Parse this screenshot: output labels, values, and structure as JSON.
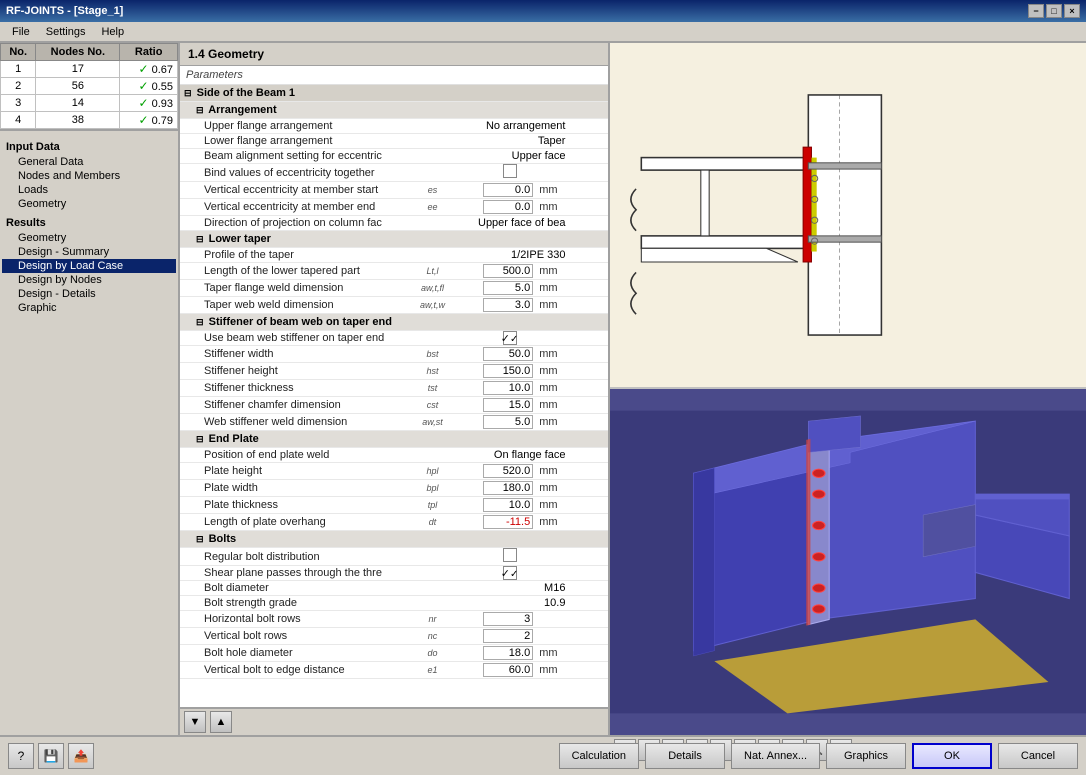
{
  "titleBar": {
    "title": "RF-JOINTS - [Stage_1]",
    "closeBtn": "×",
    "minBtn": "−",
    "maxBtn": "□"
  },
  "menuBar": {
    "items": [
      "File",
      "Settings",
      "Help"
    ]
  },
  "nodeTable": {
    "headers": [
      "No.",
      "Nodes No.",
      "Ratio"
    ],
    "rows": [
      {
        "no": 1,
        "nodes": 17,
        "ratio": "0.67",
        "ok": true
      },
      {
        "no": 2,
        "nodes": 56,
        "ratio": "0.55",
        "ok": true
      },
      {
        "no": 3,
        "nodes": 14,
        "ratio": "0.93",
        "ok": true
      },
      {
        "no": 4,
        "nodes": 38,
        "ratio": "0.79",
        "ok": true
      }
    ]
  },
  "inputTree": {
    "inputDataLabel": "Input Data",
    "items": [
      {
        "label": "General Data",
        "indent": 1
      },
      {
        "label": "Nodes and Members",
        "indent": 1
      },
      {
        "label": "Loads",
        "indent": 1
      },
      {
        "label": "Geometry",
        "indent": 1
      }
    ],
    "resultsLabel": "Results",
    "resultItems": [
      {
        "label": "Geometry",
        "indent": 1
      },
      {
        "label": "Design - Summary",
        "indent": 1
      },
      {
        "label": "Design by Load Case",
        "indent": 1
      },
      {
        "label": "Design by Nodes",
        "indent": 1
      },
      {
        "label": "Design - Details",
        "indent": 1
      },
      {
        "label": "Graphic",
        "indent": 1
      }
    ]
  },
  "centerPanel": {
    "title": "1.4 Geometry",
    "paramsLabel": "Parameters",
    "sections": [
      {
        "type": "section",
        "label": "Side of the Beam 1",
        "subsections": [
          {
            "type": "subsection",
            "label": "Arrangement",
            "rows": [
              {
                "name": "Upper flange arrangement",
                "symbol": "",
                "value": "No arrangement",
                "unit": "",
                "type": "text"
              },
              {
                "name": "Lower flange arrangement",
                "symbol": "",
                "value": "Taper",
                "unit": "",
                "type": "text"
              },
              {
                "name": "Beam alignment setting for eccentric",
                "symbol": "",
                "value": "Upper face",
                "unit": "",
                "type": "text"
              },
              {
                "name": "Bind values of eccentricity together",
                "symbol": "",
                "value": "",
                "unit": "",
                "type": "checkbox",
                "checked": false
              },
              {
                "name": "Vertical eccentricity at member start",
                "symbol": "es",
                "value": "0.0",
                "unit": "mm",
                "type": "value"
              },
              {
                "name": "Vertical eccentricity at member end",
                "symbol": "ee",
                "value": "0.0",
                "unit": "mm",
                "type": "value"
              },
              {
                "name": "Direction of projection on column fac",
                "symbol": "",
                "value": "Upper face of bea",
                "unit": "",
                "type": "text"
              }
            ]
          },
          {
            "type": "subsection",
            "label": "Lower taper",
            "rows": [
              {
                "name": "Profile of the taper",
                "symbol": "",
                "value": "1/2IPE 330",
                "unit": "",
                "type": "text"
              },
              {
                "name": "Length of the lower tapered part",
                "symbol": "Lt,l",
                "value": "500.0",
                "unit": "mm",
                "type": "value"
              },
              {
                "name": "Taper flange weld dimension",
                "symbol": "aw,t,fl",
                "value": "5.0",
                "unit": "mm",
                "type": "value"
              },
              {
                "name": "Taper web weld dimension",
                "symbol": "aw,t,w",
                "value": "3.0",
                "unit": "mm",
                "type": "value"
              }
            ]
          },
          {
            "type": "subsection",
            "label": "Stiffener of beam web on taper end",
            "rows": [
              {
                "name": "Use beam web stiffener on taper end",
                "symbol": "",
                "value": "",
                "unit": "",
                "type": "checkbox",
                "checked": true
              },
              {
                "name": "Stiffener width",
                "symbol": "bst",
                "value": "50.0",
                "unit": "mm",
                "type": "value"
              },
              {
                "name": "Stiffener height",
                "symbol": "hst",
                "value": "150.0",
                "unit": "mm",
                "type": "value"
              },
              {
                "name": "Stiffener thickness",
                "symbol": "tst",
                "value": "10.0",
                "unit": "mm",
                "type": "value"
              },
              {
                "name": "Stiffener chamfer dimension",
                "symbol": "cst",
                "value": "15.0",
                "unit": "mm",
                "type": "value"
              },
              {
                "name": "Web stiffener weld dimension",
                "symbol": "aw,st",
                "value": "5.0",
                "unit": "mm",
                "type": "value"
              }
            ]
          },
          {
            "type": "subsection",
            "label": "End Plate",
            "rows": [
              {
                "name": "Position of end plate weld",
                "symbol": "",
                "value": "On flange face",
                "unit": "",
                "type": "text"
              },
              {
                "name": "Plate height",
                "symbol": "hpl",
                "value": "520.0",
                "unit": "mm",
                "type": "value"
              },
              {
                "name": "Plate width",
                "symbol": "bpl",
                "value": "180.0",
                "unit": "mm",
                "type": "value"
              },
              {
                "name": "Plate thickness",
                "symbol": "tpl",
                "value": "10.0",
                "unit": "mm",
                "type": "value"
              },
              {
                "name": "Length of plate overhang",
                "symbol": "dt",
                "value": "-11.5",
                "unit": "mm",
                "type": "value"
              }
            ]
          },
          {
            "type": "subsection",
            "label": "Bolts",
            "rows": [
              {
                "name": "Regular bolt distribution",
                "symbol": "",
                "value": "",
                "unit": "",
                "type": "checkbox",
                "checked": false
              },
              {
                "name": "Shear plane passes through the thre",
                "symbol": "",
                "value": "",
                "unit": "",
                "type": "checkbox",
                "checked": true
              },
              {
                "name": "Bolt diameter",
                "symbol": "",
                "value": "M16",
                "unit": "",
                "type": "text"
              },
              {
                "name": "Bolt strength grade",
                "symbol": "",
                "value": "10.9",
                "unit": "",
                "type": "text"
              },
              {
                "name": "Horizontal bolt rows",
                "symbol": "nr",
                "value": "3",
                "unit": "",
                "type": "value"
              },
              {
                "name": "Vertical bolt rows",
                "symbol": "nc",
                "value": "2",
                "unit": "",
                "type": "value"
              },
              {
                "name": "Bolt hole diameter",
                "symbol": "do",
                "value": "18.0",
                "unit": "mm",
                "type": "value"
              },
              {
                "name": "Vertical bolt to edge distance",
                "symbol": "e1",
                "value": "60.0",
                "unit": "mm",
                "type": "value"
              }
            ]
          }
        ]
      }
    ],
    "navButtons": [
      "▼",
      "▲"
    ]
  },
  "toolbar": {
    "buttons": [
      "⊕",
      "⊙",
      "↔",
      "↕",
      "↗",
      "↗z",
      "↗y",
      "▣",
      "⊙",
      "⊡"
    ]
  },
  "statusBar": {
    "smallBtns": [
      "?",
      "💾",
      "📤"
    ],
    "buttons": [
      "Calculation",
      "Details",
      "Nat. Annex...",
      "Graphics",
      "OK",
      "Cancel"
    ]
  }
}
